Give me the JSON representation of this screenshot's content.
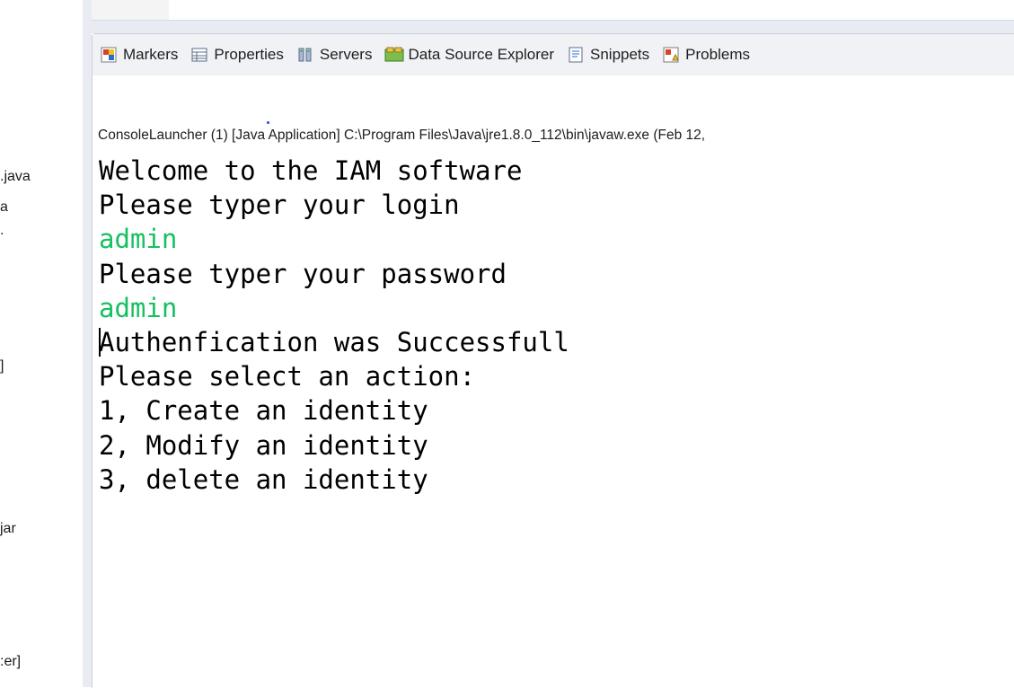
{
  "left_strip": [
    ".java",
    "a",
    ".",
    "]",
    "jar",
    ":er]"
  ],
  "tabs": [
    {
      "label": "Markers",
      "icon": "markers-icon"
    },
    {
      "label": "Properties",
      "icon": "properties-icon"
    },
    {
      "label": "Servers",
      "icon": "servers-icon"
    },
    {
      "label": "Data Source Explorer",
      "icon": "data-source-explorer-icon"
    },
    {
      "label": "Snippets",
      "icon": "snippets-icon"
    },
    {
      "label": "Problems",
      "icon": "problems-icon"
    }
  ],
  "console": {
    "launch_info": "ConsoleLauncher (1) [Java Application] C:\\Program Files\\Java\\jre1.8.0_112\\bin\\javaw.exe (Feb 12,",
    "lines": [
      {
        "text": "Welcome to the IAM software",
        "kind": "output"
      },
      {
        "text": "Please typer your login",
        "kind": "output"
      },
      {
        "text": "admin",
        "kind": "input"
      },
      {
        "text": "Please typer your password",
        "kind": "output"
      },
      {
        "text": "admin",
        "kind": "input"
      },
      {
        "text": "Authenfication was Successfull",
        "kind": "output"
      },
      {
        "text": "Please select an action:",
        "kind": "output"
      },
      {
        "text": "1, Create an identity",
        "kind": "output"
      },
      {
        "text": "2, Modify an identity",
        "kind": "output"
      },
      {
        "text": "3, delete an identity",
        "kind": "output"
      }
    ],
    "input_color": "#16c060"
  }
}
